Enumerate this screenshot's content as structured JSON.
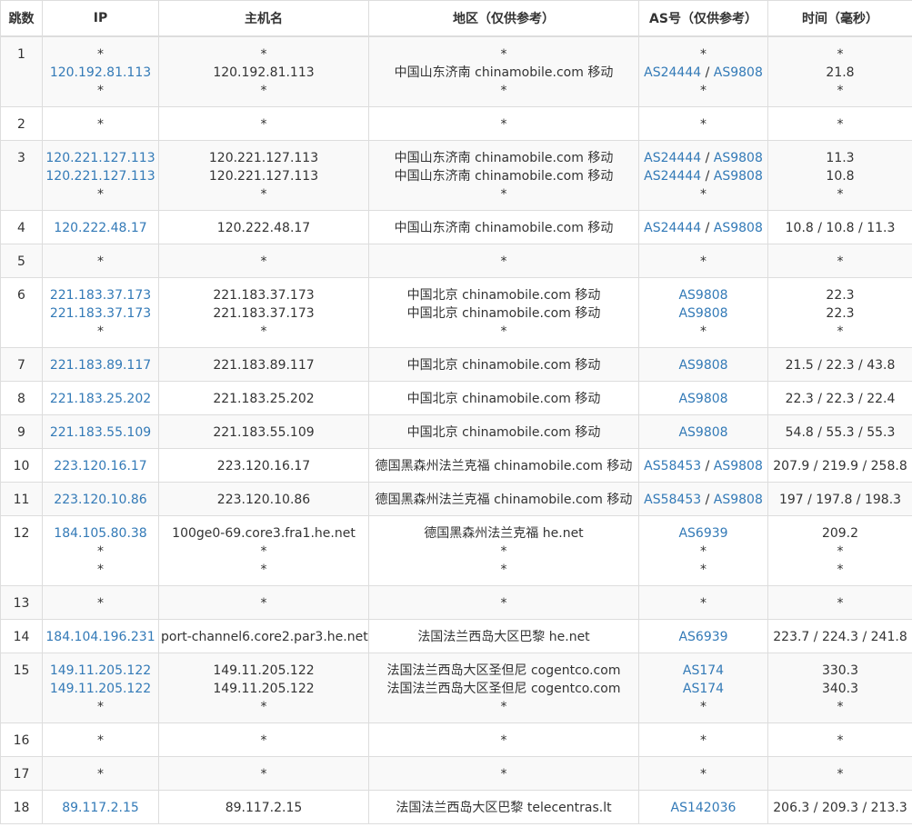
{
  "headers": [
    "跳数",
    "IP",
    "主机名",
    "地区（仅供参考）",
    "AS号（仅供参考）",
    "时间（毫秒）"
  ],
  "rows": [
    {
      "hop": "1",
      "ip": [
        "*",
        "120.192.81.113",
        "*"
      ],
      "host": [
        "*",
        "120.192.81.113",
        "*"
      ],
      "region": [
        "*",
        "中国山东济南 chinamobile.com 移动",
        "*"
      ],
      "asn": [
        [],
        [
          "AS24444",
          "AS9808"
        ],
        []
      ],
      "time": [
        "*",
        "21.8",
        "*"
      ]
    },
    {
      "hop": "2",
      "ip": [
        "*"
      ],
      "host": [
        "*"
      ],
      "region": [
        "*"
      ],
      "asn": [
        []
      ],
      "time": [
        "*"
      ]
    },
    {
      "hop": "3",
      "ip": [
        "120.221.127.113",
        "120.221.127.113",
        "*"
      ],
      "host": [
        "120.221.127.113",
        "120.221.127.113",
        "*"
      ],
      "region": [
        "中国山东济南 chinamobile.com 移动",
        "中国山东济南 chinamobile.com 移动",
        "*"
      ],
      "asn": [
        [
          "AS24444",
          "AS9808"
        ],
        [
          "AS24444",
          "AS9808"
        ],
        []
      ],
      "time": [
        "11.3",
        "10.8",
        "*"
      ]
    },
    {
      "hop": "4",
      "ip": [
        "120.222.48.17"
      ],
      "host": [
        "120.222.48.17"
      ],
      "region": [
        "中国山东济南 chinamobile.com 移动"
      ],
      "asn": [
        [
          "AS24444",
          "AS9808"
        ]
      ],
      "time": [
        "10.8 / 10.8 / 11.3"
      ]
    },
    {
      "hop": "5",
      "ip": [
        "*"
      ],
      "host": [
        "*"
      ],
      "region": [
        "*"
      ],
      "asn": [
        []
      ],
      "time": [
        "*"
      ]
    },
    {
      "hop": "6",
      "ip": [
        "221.183.37.173",
        "221.183.37.173",
        "*"
      ],
      "host": [
        "221.183.37.173",
        "221.183.37.173",
        "*"
      ],
      "region": [
        "中国北京 chinamobile.com 移动",
        "中国北京 chinamobile.com 移动",
        "*"
      ],
      "asn": [
        [
          "AS9808"
        ],
        [
          "AS9808"
        ],
        []
      ],
      "time": [
        "22.3",
        "22.3",
        "*"
      ]
    },
    {
      "hop": "7",
      "ip": [
        "221.183.89.117"
      ],
      "host": [
        "221.183.89.117"
      ],
      "region": [
        "中国北京 chinamobile.com 移动"
      ],
      "asn": [
        [
          "AS9808"
        ]
      ],
      "time": [
        "21.5 / 22.3 / 43.8"
      ]
    },
    {
      "hop": "8",
      "ip": [
        "221.183.25.202"
      ],
      "host": [
        "221.183.25.202"
      ],
      "region": [
        "中国北京 chinamobile.com 移动"
      ],
      "asn": [
        [
          "AS9808"
        ]
      ],
      "time": [
        "22.3 / 22.3 / 22.4"
      ]
    },
    {
      "hop": "9",
      "ip": [
        "221.183.55.109"
      ],
      "host": [
        "221.183.55.109"
      ],
      "region": [
        "中国北京 chinamobile.com 移动"
      ],
      "asn": [
        [
          "AS9808"
        ]
      ],
      "time": [
        "54.8 / 55.3 / 55.3"
      ]
    },
    {
      "hop": "10",
      "ip": [
        "223.120.16.17"
      ],
      "host": [
        "223.120.16.17"
      ],
      "region": [
        "德国黑森州法兰克福 chinamobile.com 移动"
      ],
      "asn": [
        [
          "AS58453",
          "AS9808"
        ]
      ],
      "time": [
        "207.9 / 219.9 / 258.8"
      ]
    },
    {
      "hop": "11",
      "ip": [
        "223.120.10.86"
      ],
      "host": [
        "223.120.10.86"
      ],
      "region": [
        "德国黑森州法兰克福 chinamobile.com 移动"
      ],
      "asn": [
        [
          "AS58453",
          "AS9808"
        ]
      ],
      "time": [
        "197 / 197.8 / 198.3"
      ]
    },
    {
      "hop": "12",
      "ip": [
        "184.105.80.38",
        "*",
        "*"
      ],
      "host": [
        "100ge0-69.core3.fra1.he.net",
        "*",
        "*"
      ],
      "region": [
        "德国黑森州法兰克福 he.net",
        "*",
        "*"
      ],
      "asn": [
        [
          "AS6939"
        ],
        [],
        []
      ],
      "time": [
        "209.2",
        "*",
        "*"
      ]
    },
    {
      "hop": "13",
      "ip": [
        "*"
      ],
      "host": [
        "*"
      ],
      "region": [
        "*"
      ],
      "asn": [
        []
      ],
      "time": [
        "*"
      ]
    },
    {
      "hop": "14",
      "ip": [
        "184.104.196.231"
      ],
      "host": [
        "port-channel6.core2.par3.he.net"
      ],
      "region": [
        "法国法兰西岛大区巴黎 he.net"
      ],
      "asn": [
        [
          "AS6939"
        ]
      ],
      "time": [
        "223.7 / 224.3 / 241.8"
      ]
    },
    {
      "hop": "15",
      "ip": [
        "149.11.205.122",
        "149.11.205.122",
        "*"
      ],
      "host": [
        "149.11.205.122",
        "149.11.205.122",
        "*"
      ],
      "region": [
        "法国法兰西岛大区圣但尼 cogentco.com",
        "法国法兰西岛大区圣但尼 cogentco.com",
        "*"
      ],
      "asn": [
        [
          "AS174"
        ],
        [
          "AS174"
        ],
        []
      ],
      "time": [
        "330.3",
        "340.3",
        "*"
      ]
    },
    {
      "hop": "16",
      "ip": [
        "*"
      ],
      "host": [
        "*"
      ],
      "region": [
        "*"
      ],
      "asn": [
        []
      ],
      "time": [
        "*"
      ]
    },
    {
      "hop": "17",
      "ip": [
        "*"
      ],
      "host": [
        "*"
      ],
      "region": [
        "*"
      ],
      "asn": [
        []
      ],
      "time": [
        "*"
      ]
    },
    {
      "hop": "18",
      "ip": [
        "89.117.2.15"
      ],
      "host": [
        "89.117.2.15"
      ],
      "region": [
        "法国法兰西岛大区巴黎 telecentras.lt"
      ],
      "asn": [
        [
          "AS142036"
        ]
      ],
      "time": [
        "206.3 / 209.3 / 213.3"
      ]
    }
  ],
  "colors": {
    "link": "#337ab7",
    "text": "#333333",
    "border": "#dddddd",
    "stripe": "#f9f9f9"
  },
  "empty_marker": "*",
  "asn_separator": " / "
}
